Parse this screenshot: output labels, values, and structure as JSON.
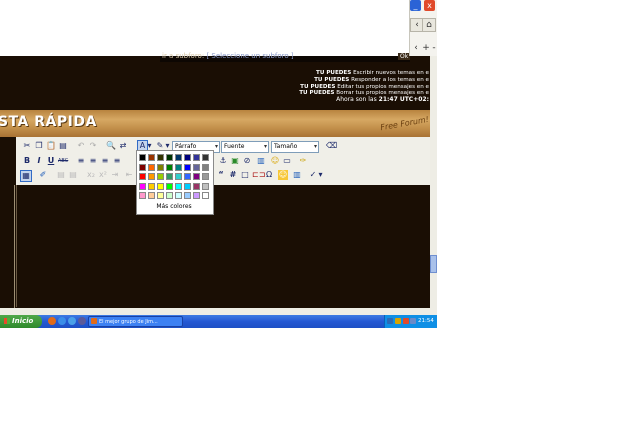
{
  "window": {
    "minimize_label": "_",
    "close_label": "x",
    "home_label": "⌂",
    "nav_labels": [
      "‹",
      "+",
      "-"
    ]
  },
  "search": {
    "prefix": "ir a subforo:",
    "select_value": "[ Seleccione un subforo ]",
    "button_label": "Ok"
  },
  "permissions": [
    {
      "bold": "TU PUEDES",
      "text": "Escribir nuevos temas en e"
    },
    {
      "bold": "TU PUEDES",
      "text": "Responder a los temas en e"
    },
    {
      "bold": "TU PUEDES",
      "text": "Editar tus propios mensajes en e"
    },
    {
      "bold": "TU PUEDES",
      "text": "Borrar tus propios mensajes en e"
    }
  ],
  "time": {
    "prefix": "Ahora son las",
    "value": "21:47 UTC+02:"
  },
  "banner": {
    "title": "STA RÁPIDA",
    "free_forum": "Free Forum!"
  },
  "toolbar": {
    "format_select": "Párrafo",
    "font_select": "Fuente",
    "size_select": "Tamaño"
  },
  "color_picker": {
    "more_colors": "Más colores",
    "rows": [
      [
        "#000000",
        "#993300",
        "#333300",
        "#003300",
        "#003366",
        "#000080",
        "#333399",
        "#333333"
      ],
      [
        "#800000",
        "#ff6600",
        "#808000",
        "#008000",
        "#008080",
        "#0000ff",
        "#666699",
        "#808080"
      ],
      [
        "#ff0000",
        "#ff9900",
        "#99cc00",
        "#339966",
        "#33cccc",
        "#3366ff",
        "#800080",
        "#999999"
      ],
      [
        "#ff00ff",
        "#ffcc00",
        "#ffff00",
        "#00ff00",
        "#00ffff",
        "#00ccff",
        "#993366",
        "#c0c0c0"
      ],
      [
        "#ff99cc",
        "#ffcc99",
        "#ffff99",
        "#ccffcc",
        "#ccffff",
        "#99ccff",
        "#cc99ff",
        "#ffffff"
      ]
    ]
  },
  "taskbar": {
    "start_label": "Inicio",
    "task_label": "El mejor grupo de Jim...",
    "clock": "21:54"
  }
}
